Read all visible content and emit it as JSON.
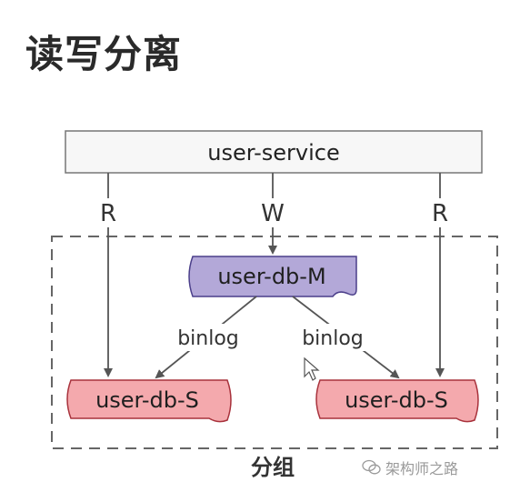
{
  "title": "读写分离",
  "service": {
    "label": "user-service"
  },
  "edges": {
    "read_left": "R",
    "write": "W",
    "read_right": "R",
    "binlog_left": "binlog",
    "binlog_right": "binlog"
  },
  "nodes": {
    "master": "user-db-M",
    "slave_left": "user-db-S",
    "slave_right": "user-db-S"
  },
  "group": {
    "label": "分组"
  },
  "watermark": {
    "text": "架构师之路"
  },
  "colors": {
    "master_fill": "#b3a8d8",
    "master_stroke": "#4b3f8a",
    "slave_fill": "#f4a9ad",
    "slave_stroke": "#a8323c",
    "service_fill": "#f7f7f7",
    "arrow": "#555555"
  }
}
